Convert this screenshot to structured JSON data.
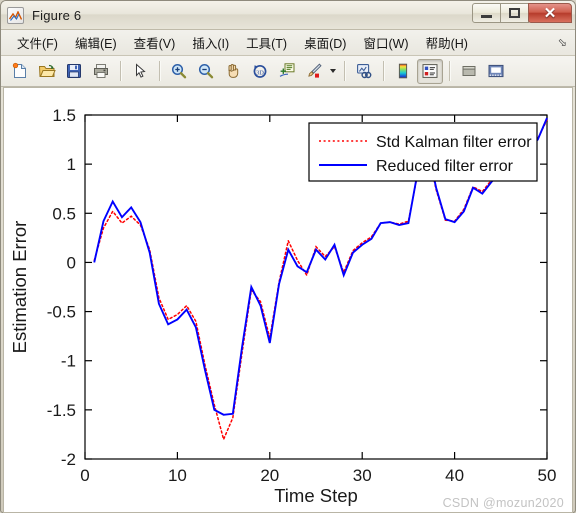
{
  "window": {
    "title": "Figure 6",
    "icon": "matlab-figure-icon",
    "buttons": [
      {
        "name": "minimize-button",
        "glyph": "minimize-icon",
        "label": ""
      },
      {
        "name": "maximize-button",
        "glyph": "maximize-icon",
        "label": ""
      },
      {
        "name": "close-button",
        "glyph": "close-icon",
        "label": "✕"
      }
    ]
  },
  "menubar": {
    "items": [
      {
        "label": "文件(F)"
      },
      {
        "label": "编辑(E)"
      },
      {
        "label": "查看(V)"
      },
      {
        "label": "插入(I)"
      },
      {
        "label": "工具(T)"
      },
      {
        "label": "桌面(D)"
      },
      {
        "label": "窗口(W)"
      },
      {
        "label": "帮助(H)"
      }
    ],
    "overflow_glyph": "⬂"
  },
  "toolbar": {
    "buttons": [
      {
        "name": "new-figure-button",
        "icon": "new-document-icon"
      },
      {
        "name": "open-file-button",
        "icon": "open-folder-icon"
      },
      {
        "name": "save-figure-button",
        "icon": "save-disk-icon"
      },
      {
        "name": "print-figure-button",
        "icon": "printer-icon"
      },
      {
        "name": "edit-plot-button",
        "icon": "arrow-pointer-icon"
      },
      {
        "name": "zoom-in-button",
        "icon": "magnifier-plus-icon"
      },
      {
        "name": "zoom-out-button",
        "icon": "magnifier-minus-icon"
      },
      {
        "name": "pan-button",
        "icon": "hand-pan-icon"
      },
      {
        "name": "rotate-3d-button",
        "icon": "rotate-3d-icon"
      },
      {
        "name": "data-cursor-button",
        "icon": "data-cursor-icon"
      },
      {
        "name": "brush-button",
        "icon": "brush-icon"
      },
      {
        "name": "link-plot-button",
        "icon": "link-plot-icon"
      },
      {
        "name": "colorbar-button",
        "icon": "colorbar-icon"
      },
      {
        "name": "legend-button",
        "icon": "legend-icon"
      },
      {
        "name": "hide-plot-tools-button",
        "icon": "hide-plot-tools-icon"
      },
      {
        "name": "show-plot-tools-button",
        "icon": "show-plot-tools-icon"
      }
    ]
  },
  "figure": {
    "watermark": "CSDN @mozun2020"
  },
  "chart_data": {
    "type": "line",
    "title": "",
    "xlabel": "Time Step",
    "ylabel": "Estimation Error",
    "xlim": [
      0,
      50
    ],
    "ylim": [
      -2,
      1.5
    ],
    "xticks": [
      0,
      10,
      20,
      30,
      40,
      50
    ],
    "yticks": [
      -2,
      -1.5,
      -1,
      -0.5,
      0,
      0.5,
      1,
      1.5
    ],
    "grid": false,
    "legend_position": "top-right",
    "colors": {
      "std_kalman": "#ff0000",
      "reduced": "#0000ff"
    },
    "x": [
      1,
      2,
      3,
      4,
      5,
      6,
      7,
      8,
      9,
      10,
      11,
      12,
      13,
      14,
      15,
      16,
      17,
      18,
      19,
      20,
      21,
      22,
      23,
      24,
      25,
      26,
      27,
      28,
      29,
      30,
      31,
      32,
      33,
      34,
      35,
      36,
      37,
      38,
      39,
      40,
      41,
      42,
      43,
      44,
      45,
      46,
      47,
      48,
      49,
      50
    ],
    "series": [
      {
        "name": "Std Kalman filter error",
        "style": "dotted",
        "color": "#ff0000",
        "values": [
          0.02,
          0.35,
          0.52,
          0.4,
          0.47,
          0.38,
          0.13,
          -0.36,
          -0.58,
          -0.53,
          -0.44,
          -0.6,
          -1.05,
          -1.45,
          -1.8,
          -1.58,
          -0.92,
          -0.28,
          -0.4,
          -0.77,
          -0.2,
          0.22,
          0.02,
          -0.13,
          0.16,
          0.06,
          0.16,
          -0.1,
          0.12,
          0.2,
          0.26,
          0.4,
          0.41,
          0.39,
          0.42,
          0.9,
          1.18,
          0.74,
          0.43,
          0.42,
          0.54,
          0.77,
          0.72,
          0.84,
          0.93,
          1.06,
          1.1,
          1.17,
          1.26,
          1.45
        ]
      },
      {
        "name": "Reduced filter error",
        "style": "solid",
        "color": "#0000ff",
        "values": [
          0.0,
          0.42,
          0.62,
          0.46,
          0.56,
          0.41,
          0.1,
          -0.42,
          -0.63,
          -0.58,
          -0.48,
          -0.66,
          -1.1,
          -1.5,
          -1.55,
          -1.54,
          -0.86,
          -0.25,
          -0.44,
          -0.82,
          -0.22,
          0.13,
          -0.04,
          -0.1,
          0.13,
          0.03,
          0.18,
          -0.13,
          0.1,
          0.18,
          0.24,
          0.4,
          0.41,
          0.38,
          0.4,
          0.92,
          1.2,
          0.76,
          0.44,
          0.41,
          0.52,
          0.76,
          0.7,
          0.82,
          0.92,
          1.04,
          1.09,
          1.16,
          1.25,
          1.47
        ]
      }
    ]
  }
}
